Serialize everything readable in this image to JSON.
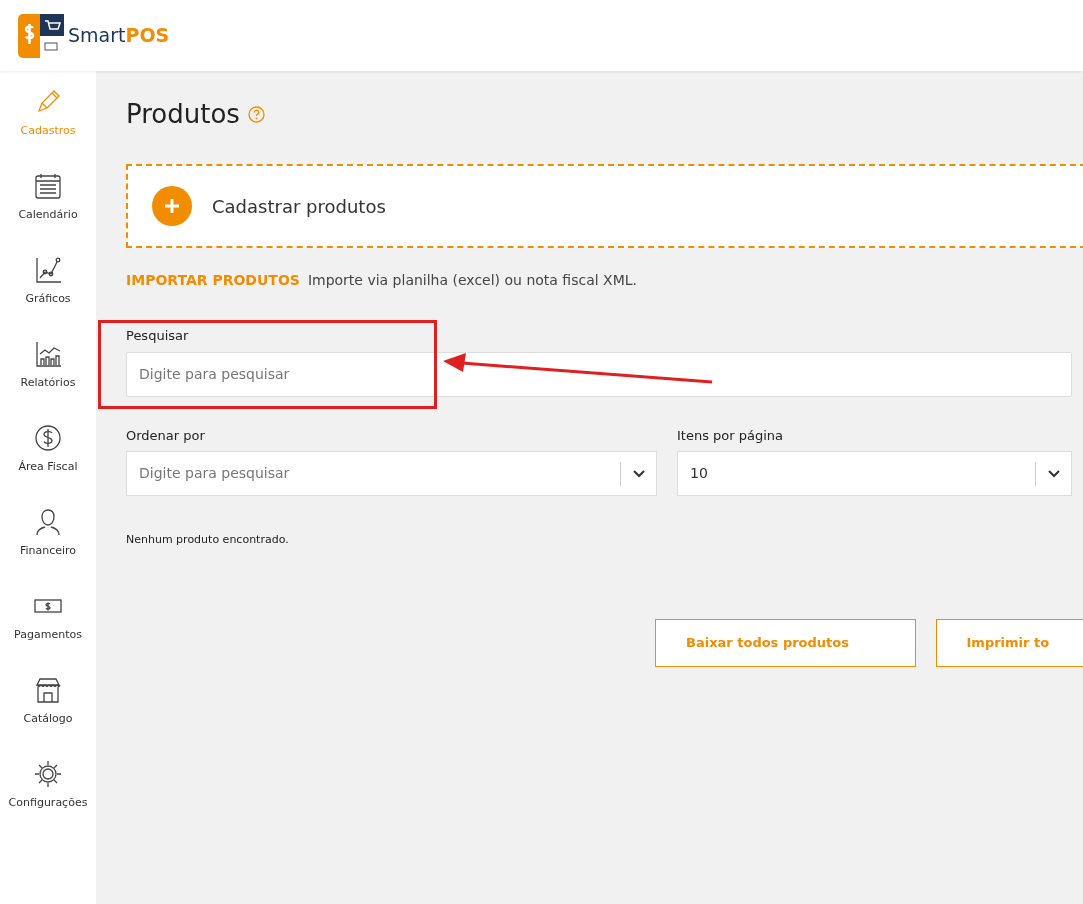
{
  "brand": {
    "name_part1": "Smart",
    "name_part2": "POS"
  },
  "sidebar": {
    "items": [
      {
        "kind": "pencil",
        "label": "Cadastros",
        "selected": true
      },
      {
        "kind": "calendar",
        "label": "Calendário",
        "selected": false
      },
      {
        "kind": "chart",
        "label": "Gráficos",
        "selected": false
      },
      {
        "kind": "report",
        "label": "Relatórios",
        "selected": false
      },
      {
        "kind": "dollar",
        "label": "Área Fiscal",
        "selected": false
      },
      {
        "kind": "person",
        "label": "Financeiro",
        "selected": false
      },
      {
        "kind": "bill",
        "label": "Pagamentos",
        "selected": false
      },
      {
        "kind": "store",
        "label": "Catálogo",
        "selected": false
      },
      {
        "kind": "gear",
        "label": "Configurações",
        "selected": false
      }
    ]
  },
  "page": {
    "title": "Produtos"
  },
  "add_card": {
    "label": "Cadastrar produtos"
  },
  "import": {
    "link": "IMPORTAR PRODUTOS",
    "description": "Importe via planilha (excel) ou nota fiscal XML."
  },
  "search": {
    "label": "Pesquisar",
    "placeholder": "Digite para pesquisar"
  },
  "sort": {
    "label": "Ordenar por",
    "placeholder": "Digite para pesquisar"
  },
  "per_page": {
    "label": "Itens por página",
    "value": "10"
  },
  "empty_message": "Nenhum produto encontrado.",
  "buttons": [
    "Baixar todos produtos",
    "Imprimir to"
  ]
}
